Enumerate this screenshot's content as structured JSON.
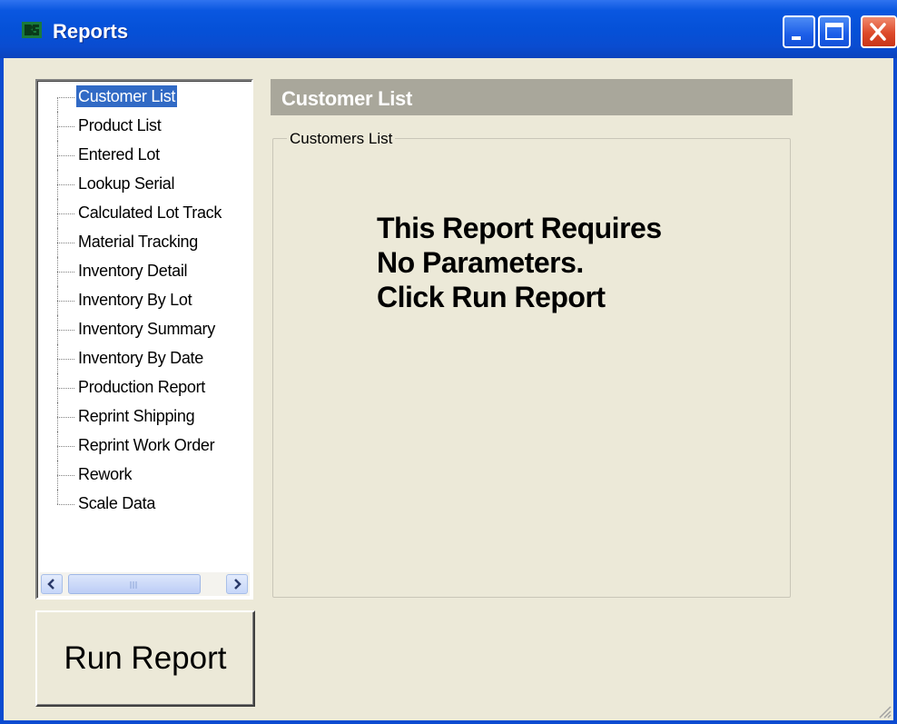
{
  "window": {
    "title": "Reports",
    "buttons": [
      "minimize",
      "maximize",
      "close"
    ]
  },
  "tree": {
    "items": [
      {
        "label": "Customer List",
        "selected": true
      },
      {
        "label": "Product List"
      },
      {
        "label": "Entered Lot"
      },
      {
        "label": "Lookup Serial"
      },
      {
        "label": "Calculated Lot Track"
      },
      {
        "label": "Material Tracking"
      },
      {
        "label": "Inventory Detail"
      },
      {
        "label": "Inventory By Lot"
      },
      {
        "label": "Inventory Summary"
      },
      {
        "label": "Inventory By Date"
      },
      {
        "label": "Production Report"
      },
      {
        "label": "Reprint Shipping"
      },
      {
        "label": "Reprint Work Order"
      },
      {
        "label": "Rework"
      },
      {
        "label": "Scale Data"
      }
    ]
  },
  "panel": {
    "header": "Customer List",
    "group_title": "Customers List",
    "message_lines": [
      "This Report Requires",
      "No Parameters.",
      "Click Run Report"
    ]
  },
  "run_button": {
    "label": "Run Report"
  },
  "colors": {
    "titlebar": "#0551d8",
    "selection": "#316ac5",
    "panel_header": "#a9a79b",
    "face": "#ece9d8"
  },
  "icons": {
    "app": "app-logo-icon",
    "minimize": "minimize-icon",
    "maximize": "maximize-icon",
    "close": "close-icon",
    "scroll_left": "chevron-left-icon",
    "scroll_right": "chevron-right-icon"
  }
}
